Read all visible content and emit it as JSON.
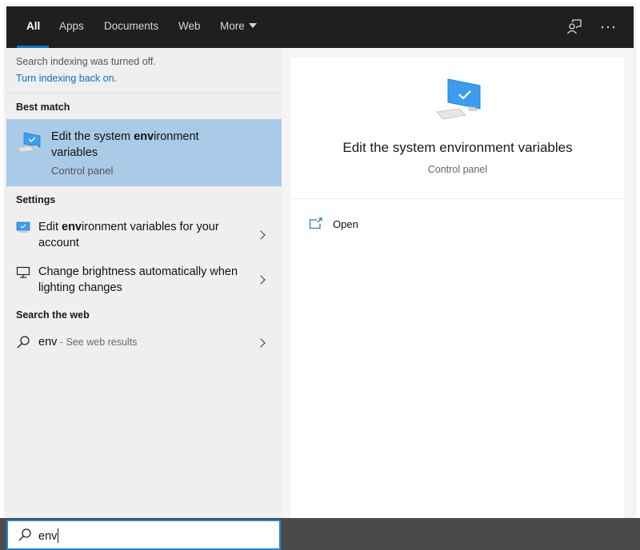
{
  "tabs": [
    {
      "label": "All",
      "active": true
    },
    {
      "label": "Apps",
      "active": false
    },
    {
      "label": "Documents",
      "active": false
    },
    {
      "label": "Web",
      "active": false
    },
    {
      "label": "More",
      "active": false
    }
  ],
  "topbar_icons": [
    "feedback-icon",
    "more-options-icon"
  ],
  "indexing": {
    "message": "Search indexing was turned off.",
    "link": "Turn indexing back on."
  },
  "best_match": {
    "section_label": "Best match",
    "title_pre": "Edit the system ",
    "title_bold": "env",
    "title_post": "ironment variables",
    "subtitle": "Control panel",
    "icon": "computer-check-icon"
  },
  "settings": {
    "section_label": "Settings",
    "items": [
      {
        "pre": "Edit ",
        "bold": "env",
        "post": "ironment variables for your account",
        "icon": "computer-check-icon"
      },
      {
        "pre": "Change brightness automatically when lighting changes",
        "bold": "",
        "post": "",
        "icon": "monitor-icon"
      }
    ]
  },
  "web": {
    "section_label": "Search the web",
    "query": "env",
    "suffix": " - See web results",
    "icon": "search-icon"
  },
  "detail": {
    "title": "Edit the system environment variables",
    "subtitle": "Control panel",
    "actions": [
      {
        "label": "Open",
        "icon": "open-icon"
      }
    ]
  },
  "search": {
    "value": "env",
    "icon": "search-icon"
  },
  "colors": {
    "accent": "#0078d7",
    "selected_bg": "#a9cbe7",
    "topbar_bg": "#1f1f1f",
    "link": "#0a6fc2"
  }
}
